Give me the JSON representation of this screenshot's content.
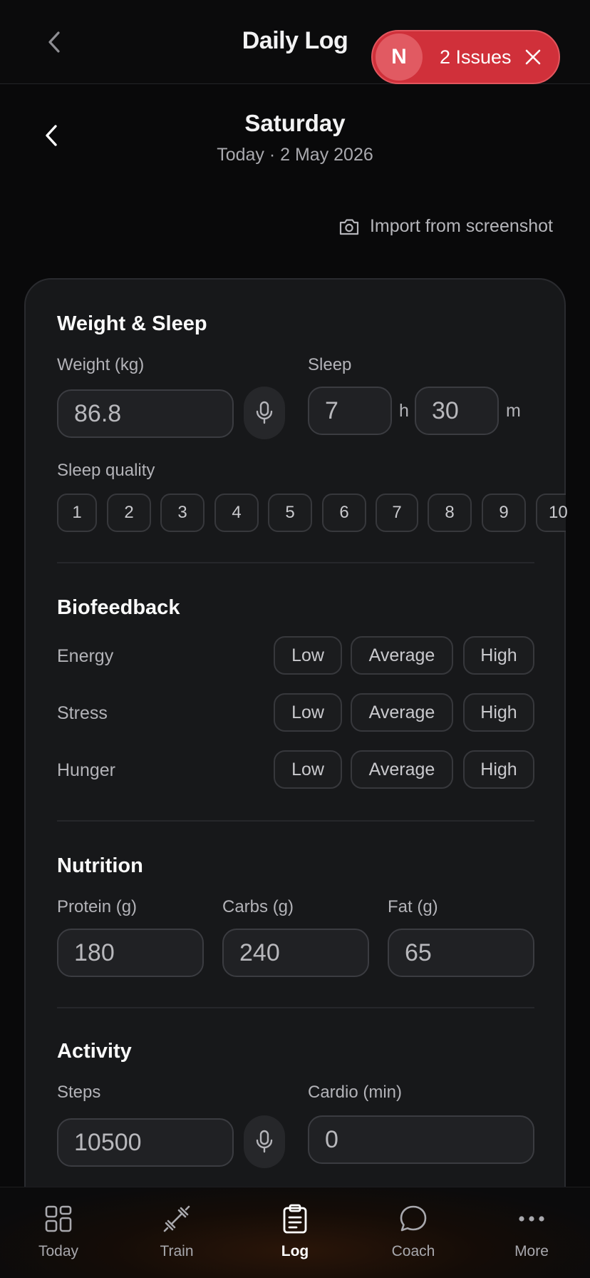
{
  "header": {
    "title": "Daily Log"
  },
  "issues_badge": {
    "logo_letter": "N",
    "label": "2 Issues",
    "color": "#d0303a"
  },
  "date": {
    "day": "Saturday",
    "subtitle": "Today · 2 May 2026"
  },
  "import": {
    "label": "Import from screenshot"
  },
  "weight_sleep": {
    "title": "Weight & Sleep",
    "weight_label": "Weight (kg)",
    "weight_placeholder": "86.8",
    "sleep_label": "Sleep",
    "sleep_hours_placeholder": "7",
    "hours_unit": "h",
    "sleep_minutes_placeholder": "30",
    "minutes_unit": "m",
    "quality_label": "Sleep quality",
    "quality_options": [
      "1",
      "2",
      "3",
      "4",
      "5",
      "6",
      "7",
      "8",
      "9",
      "10"
    ]
  },
  "biofeedback": {
    "title": "Biofeedback",
    "rows": [
      {
        "label": "Energy",
        "options": [
          "Low",
          "Average",
          "High"
        ]
      },
      {
        "label": "Stress",
        "options": [
          "Low",
          "Average",
          "High"
        ]
      },
      {
        "label": "Hunger",
        "options": [
          "Low",
          "Average",
          "High"
        ]
      }
    ]
  },
  "nutrition": {
    "title": "Nutrition",
    "protein_label": "Protein (g)",
    "protein_placeholder": "180",
    "carbs_label": "Carbs (g)",
    "carbs_placeholder": "240",
    "fat_label": "Fat (g)",
    "fat_placeholder": "65"
  },
  "activity": {
    "title": "Activity",
    "steps_label": "Steps",
    "steps_placeholder": "10500",
    "cardio_label": "Cardio (min)",
    "cardio_placeholder": "0"
  },
  "nav": {
    "items": [
      {
        "label": "Today",
        "icon": "grid-icon"
      },
      {
        "label": "Train",
        "icon": "dumbbell-icon"
      },
      {
        "label": "Log",
        "icon": "clipboard-icon",
        "active": true
      },
      {
        "label": "Coach",
        "icon": "chat-bubble-icon"
      },
      {
        "label": "More",
        "icon": "more-dots-icon"
      }
    ]
  }
}
